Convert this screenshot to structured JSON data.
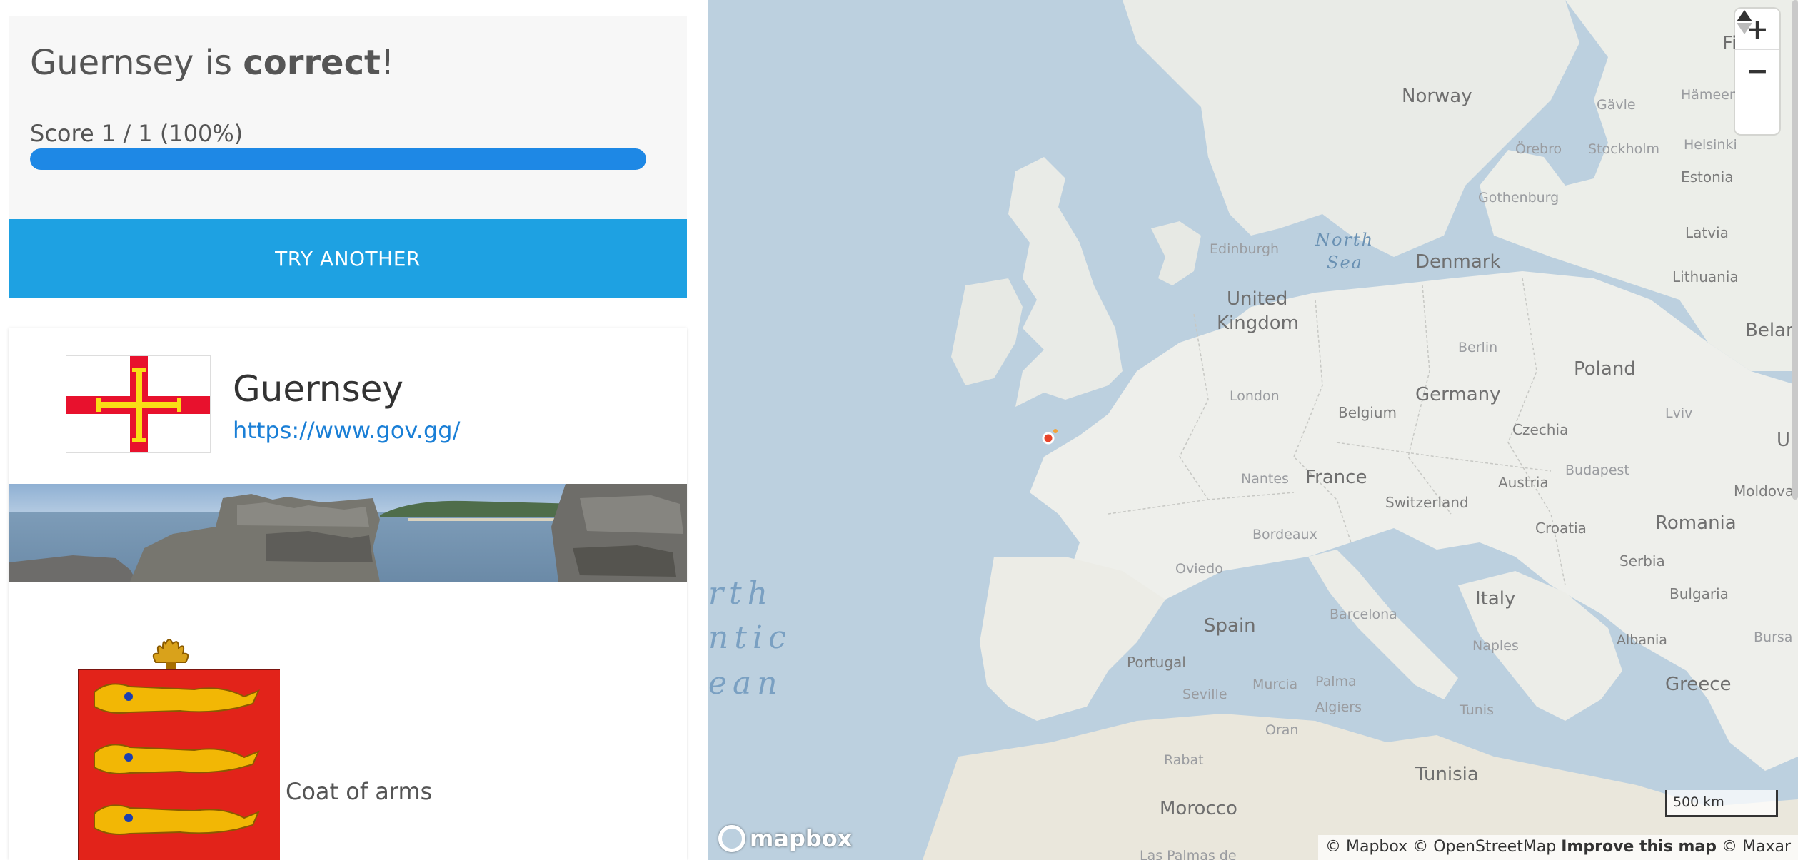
{
  "result": {
    "prefix": "Guernsey is ",
    "verdict": "correct",
    "suffix": "!",
    "score_label": "Score 1 / 1 (100%)",
    "score_fraction": 1.0,
    "progress_color": "#1e88e5"
  },
  "actions": {
    "try_another": "TRY ANOTHER",
    "button_color": "#1ea1e2"
  },
  "country": {
    "name": "Guernsey",
    "url": "https://www.gov.gg/",
    "flag_icon": "guernsey-flag",
    "coat_of_arms_label": "Coat of arms",
    "coat_of_arms_icon": "guernsey-coat-of-arms"
  },
  "map": {
    "controls": {
      "zoom_in": "+",
      "zoom_out": "−",
      "compass": "▲"
    },
    "scale": "500 km",
    "logo": "mapbox",
    "attribution": {
      "mapbox": "© Mapbox",
      "osm": "© OpenStreetMap",
      "improve": "Improve this map",
      "maxar": "© Maxar"
    },
    "marker_color": "#e8442b",
    "labels": {
      "countries": [
        "Norway",
        "Denmark",
        "United",
        "Kingdom",
        "Germany",
        "Poland",
        "Belgium",
        "France",
        "Czechia",
        "Austria",
        "Switzerland",
        "Croatia",
        "Romania",
        "Serbia",
        "Bulgaria",
        "Italy",
        "Spain",
        "Portugal",
        "Greece",
        "Albania",
        "Tunisia",
        "Morocco",
        "Estonia",
        "Latvia",
        "Lithuania",
        "Belarus",
        "Moldova",
        "Finlan",
        "Ukr"
      ],
      "cities": [
        "Edinburgh",
        "London",
        "Nantes",
        "Bordeaux",
        "Oviedo",
        "Barcelona",
        "Berlin",
        "Gothenburg",
        "Örebro",
        "Stockholm",
        "Helsinki",
        "Hämeenlinna",
        "Gävle",
        "Lviv",
        "Budapest",
        "Naples",
        "Palma",
        "Murcia",
        "Seville",
        "Algiers",
        "Oran",
        "Tunis",
        "Rabat",
        "Bursa",
        "Las Palmas de"
      ],
      "seas": [
        "North",
        "Sea"
      ],
      "ocean": [
        "rth",
        "ntic",
        "ean"
      ]
    }
  }
}
